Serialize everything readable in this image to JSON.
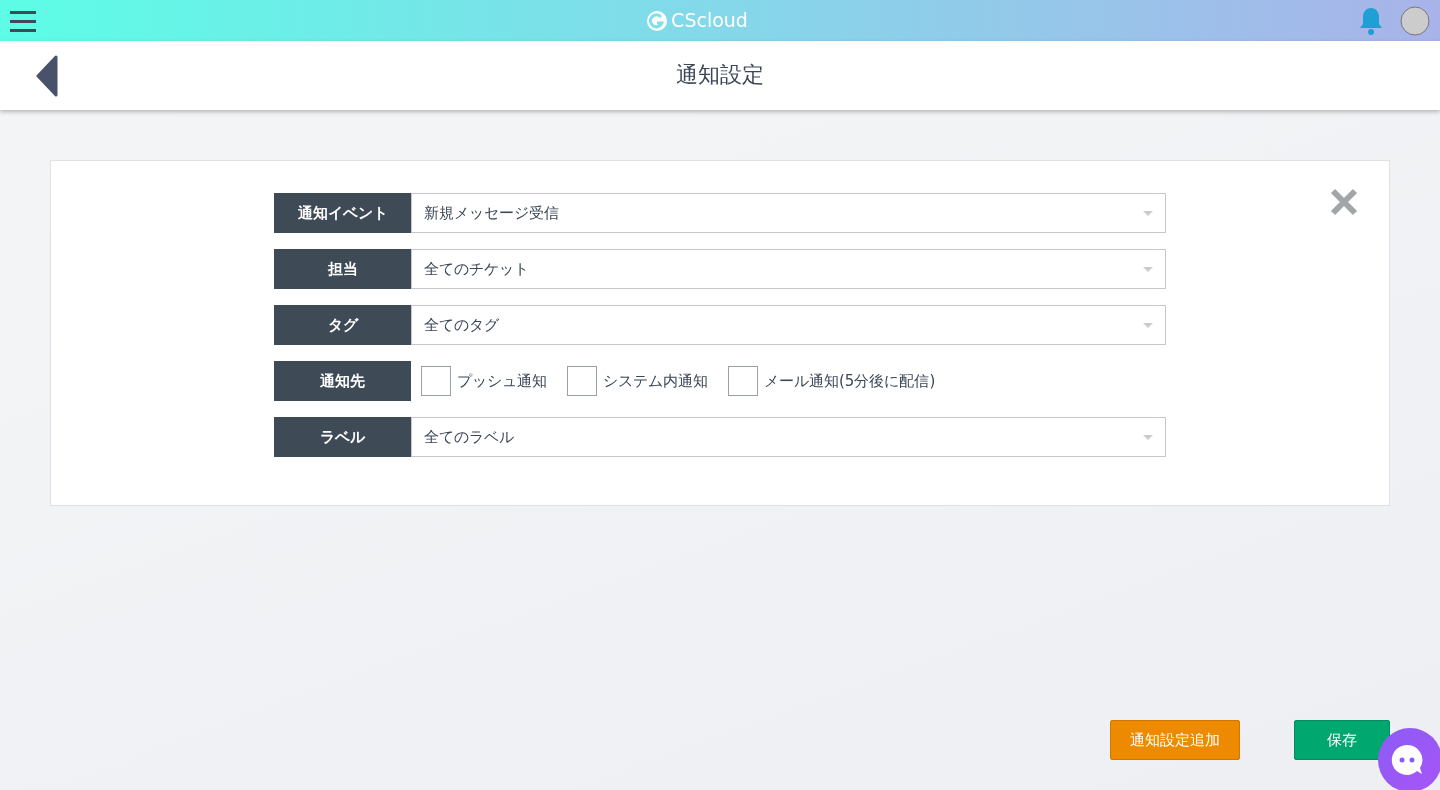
{
  "top_bar": {
    "logo": "CScloud"
  },
  "header": {
    "title": "通知設定"
  },
  "form": {
    "rows": [
      {
        "kind": "select",
        "label": "通知イベント",
        "value": "新規メッセージ受信"
      },
      {
        "kind": "select",
        "label": "担当",
        "value": "全てのチケット"
      },
      {
        "kind": "select",
        "label": "タグ",
        "value": "全てのタグ"
      },
      {
        "kind": "checkboxes",
        "label": "通知先",
        "options": [
          {
            "label": "プッシュ通知",
            "checked": false
          },
          {
            "label": "システム内通知",
            "checked": false
          },
          {
            "label": "メール通知(5分後に配信)",
            "checked": false
          }
        ]
      },
      {
        "kind": "select",
        "label": "ラベル",
        "value": "全てのラベル"
      }
    ]
  },
  "buttons": [
    {
      "label": "通知設定追加",
      "kind": "warning"
    },
    {
      "label": "保存",
      "kind": "success"
    }
  ]
}
